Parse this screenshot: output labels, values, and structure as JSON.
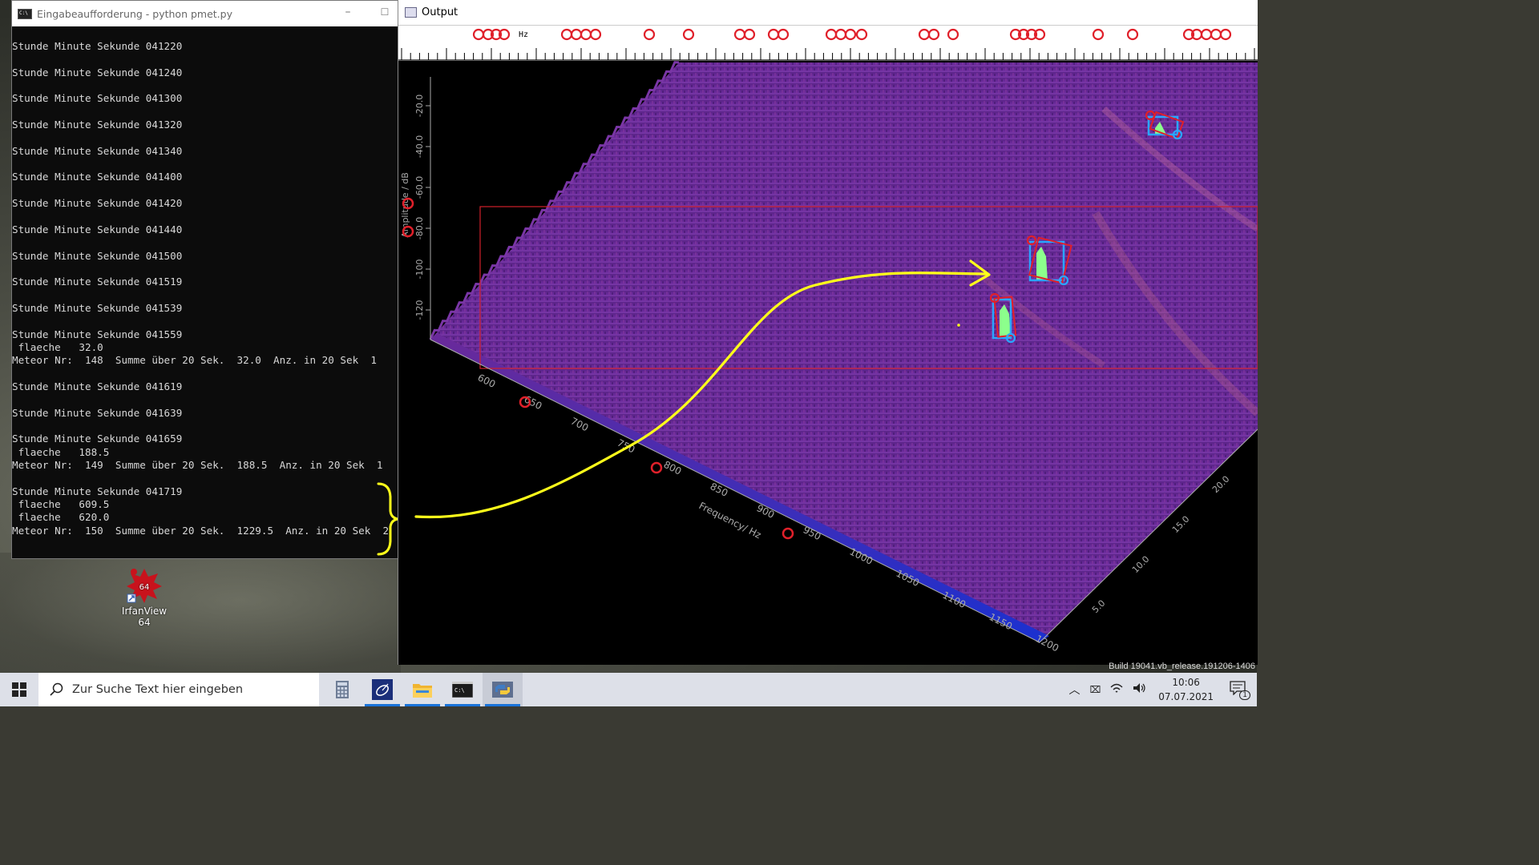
{
  "console": {
    "title": "Eingabeaufforderung - python  pmet.py",
    "lines": [
      "Stunde Minute Sekunde 041220",
      "",
      "Stunde Minute Sekunde 041240",
      "",
      "Stunde Minute Sekunde 041300",
      "",
      "Stunde Minute Sekunde 041320",
      "",
      "Stunde Minute Sekunde 041340",
      "",
      "Stunde Minute Sekunde 041400",
      "",
      "Stunde Minute Sekunde 041420",
      "",
      "Stunde Minute Sekunde 041440",
      "",
      "Stunde Minute Sekunde 041500",
      "",
      "Stunde Minute Sekunde 041519",
      "",
      "Stunde Minute Sekunde 041539",
      "",
      "Stunde Minute Sekunde 041559",
      " flaeche   32.0",
      "Meteor Nr:  148  Summe über 20 Sek.  32.0  Anz. in 20 Sek  1",
      "",
      "Stunde Minute Sekunde 041619",
      "",
      "Stunde Minute Sekunde 041639",
      "",
      "Stunde Minute Sekunde 041659",
      " flaeche   188.5",
      "Meteor Nr:  149  Summe über 20 Sek.  188.5  Anz. in 20 Sek  1",
      "",
      "Stunde Minute Sekunde 041719",
      " flaeche   609.5",
      " flaeche   620.0",
      "Meteor Nr:  150  Summe über 20 Sek.  1229.5  Anz. in 20 Sek  2"
    ]
  },
  "desktop_icon": {
    "label": "IrfanView 64",
    "badge": "64"
  },
  "output": {
    "title": "Output",
    "ruler_unit": "Hz",
    "y_axis_label": "Amplitude / dB",
    "y_ticks": [
      "-20.0",
      "-40.0",
      "-60.0",
      "-80.0",
      "-100",
      "-120"
    ],
    "x_axis_label": "Frequency/ Hz",
    "x_ticks": [
      "600",
      "650",
      "700",
      "750",
      "800",
      "850",
      "900",
      "950",
      "1000",
      "1050",
      "1100",
      "1150",
      "1200"
    ],
    "z_ticks": [
      "5.0",
      "10.0",
      "15.0",
      "20.0"
    ]
  },
  "build_text": "Build 19041.vb_release.191206-1406",
  "taskbar": {
    "search_placeholder": "Zur Suche Text hier eingeben",
    "time": "10:06",
    "date": "07.07.2021",
    "notification_count": "1"
  },
  "colors": {
    "annotation_yellow": "#ffff1a",
    "detection_red": "#e0202a",
    "detection_blue": "#2aa6ff",
    "meteor_green": "#8cff8c",
    "spectrum_purple": "#6a2a9a"
  }
}
